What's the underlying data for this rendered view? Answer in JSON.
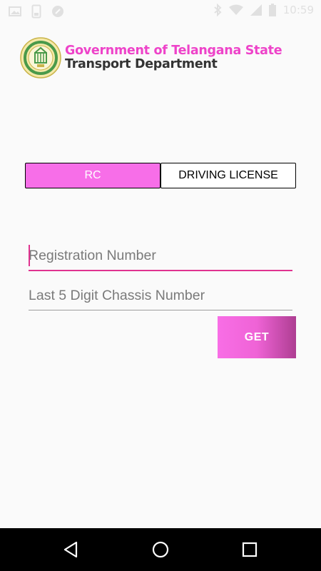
{
  "status_bar": {
    "time": "10:59",
    "icons": [
      "photo-icon",
      "sim-icon",
      "notification-circle-icon",
      "bluetooth-icon",
      "wifi-icon",
      "signal-icon",
      "battery-icon"
    ]
  },
  "header": {
    "logo_icon": "telangana-emblem-icon",
    "gov_title": "Government of Telangana State",
    "dept_title": "Transport Department"
  },
  "tabs": [
    {
      "label": "RC",
      "selected": true
    },
    {
      "label": "DRIVING LICENSE",
      "selected": false
    }
  ],
  "form": {
    "registration": {
      "value": "",
      "placeholder": "Registration Number"
    },
    "chassis": {
      "value": "",
      "placeholder": "Last 5 Digit Chassis Number"
    },
    "submit_label": "GET"
  },
  "nav_bar": {
    "icons": [
      "back-icon",
      "home-icon",
      "recents-icon"
    ]
  },
  "colors": {
    "accent": "#f76ee8",
    "focus_underline": "#e0338f",
    "title_pink": "#ee43c9",
    "button_dark": "#ae3e92"
  }
}
